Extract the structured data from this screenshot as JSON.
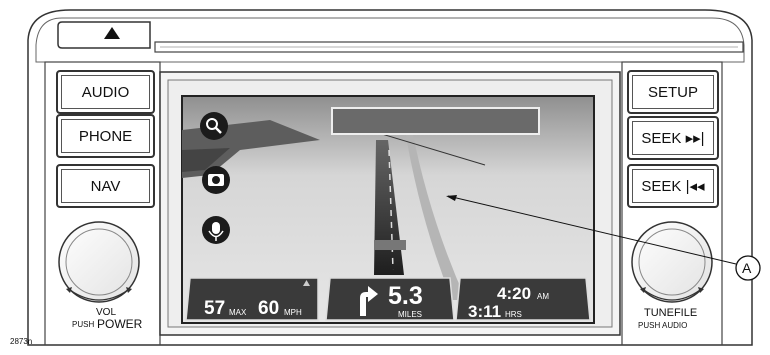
{
  "eject_icon": "eject-triangle-icon",
  "left_buttons": [
    {
      "name": "audio-button",
      "label": "AUDIO"
    },
    {
      "name": "phone-button",
      "label": "PHONE"
    },
    {
      "name": "nav-button",
      "label": "NAV"
    }
  ],
  "right_buttons": [
    {
      "name": "setup-button",
      "label": "SETUP"
    },
    {
      "name": "seek-forward-button",
      "label": "SEEK ▸▸|"
    },
    {
      "name": "seek-back-button",
      "label": "SEEK |◂◂"
    }
  ],
  "left_knob": {
    "vol": "VOL",
    "push": "PUSH",
    "power": "POWER"
  },
  "right_knob": {
    "tunefile": "TUNEFILE",
    "push_audio": "PUSH AUDIO"
  },
  "screen_icons": [
    "search-icon",
    "camera-icon",
    "microphone-icon"
  ],
  "bottom_panels": {
    "speed": {
      "value": "57",
      "max_label": "MAX",
      "limit": "60",
      "unit": "MPH"
    },
    "distance": {
      "value": "5.3",
      "unit": "MILES"
    },
    "time": {
      "clock": "4:20",
      "ampm": "AM",
      "remaining": "3:11",
      "remaining_unit": "HRS"
    }
  },
  "callout": "A",
  "figure_id": "2873n"
}
